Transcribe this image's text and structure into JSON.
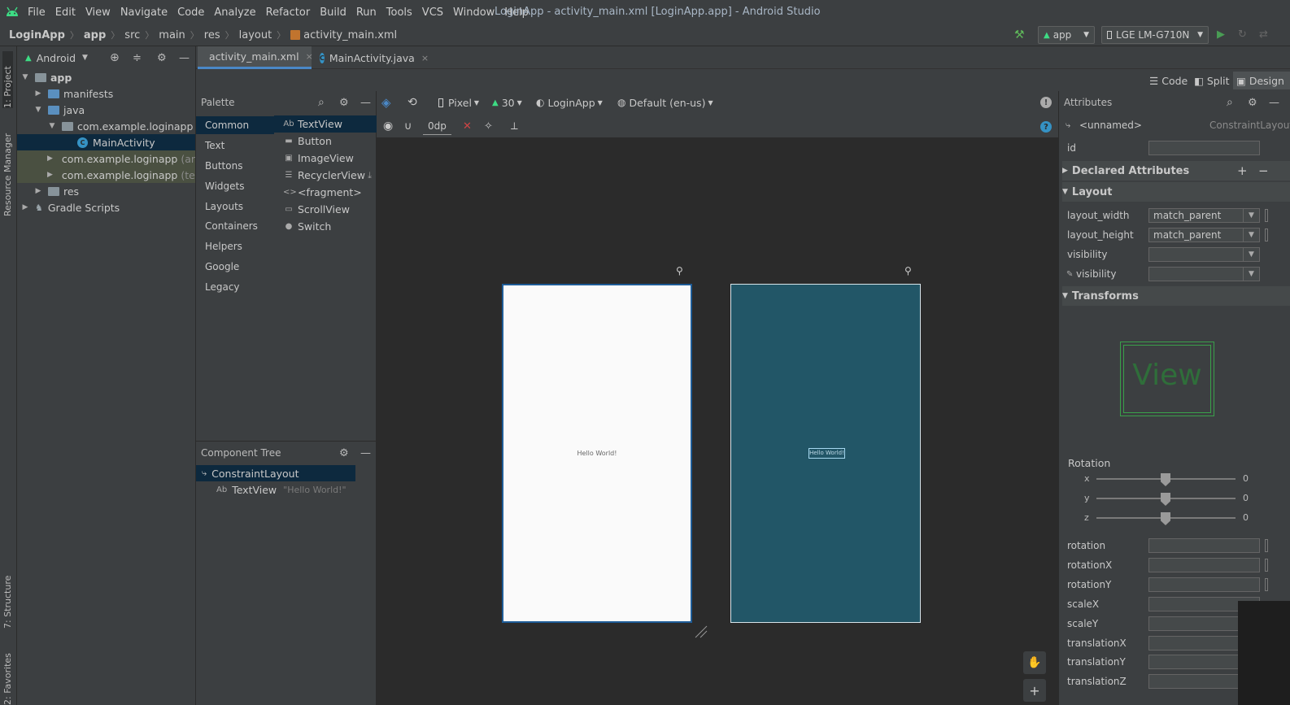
{
  "window": {
    "title": "LoginApp - activity_main.xml [LoginApp.app] - Android Studio",
    "menu": [
      "File",
      "Edit",
      "View",
      "Navigate",
      "Code",
      "Analyze",
      "Refactor",
      "Build",
      "Run",
      "Tools",
      "VCS",
      "Window",
      "Help"
    ]
  },
  "breadcrumb": [
    "LoginApp",
    "app",
    "src",
    "main",
    "res",
    "layout",
    "activity_main.xml"
  ],
  "run_config": {
    "module": "app",
    "device": "LGE LM-G710N"
  },
  "left_strip": {
    "project": "1: Project",
    "resource_manager": "Resource Manager",
    "structure": "7: Structure",
    "favorites": "2: Favorites"
  },
  "project_panel": {
    "view_mode": "Android",
    "tree": [
      {
        "label": "app",
        "suffix": ""
      },
      {
        "label": "manifests",
        "suffix": ""
      },
      {
        "label": "java",
        "suffix": ""
      },
      {
        "label": "com.example.loginapp",
        "suffix": ""
      },
      {
        "label": "MainActivity",
        "suffix": ""
      },
      {
        "label": "com.example.loginapp",
        "suffix": "(and"
      },
      {
        "label": "com.example.loginapp",
        "suffix": "(test"
      },
      {
        "label": "res",
        "suffix": ""
      },
      {
        "label": "Gradle Scripts",
        "suffix": ""
      }
    ]
  },
  "editor": {
    "tabs": [
      {
        "label": "activity_main.xml",
        "close": "×"
      },
      {
        "label": "MainActivity.java",
        "close": "×"
      }
    ],
    "modes": {
      "code": "Code",
      "split": "Split",
      "design": "Design"
    }
  },
  "palette": {
    "title": "Palette",
    "categories": [
      "Common",
      "Text",
      "Buttons",
      "Widgets",
      "Layouts",
      "Containers",
      "Helpers",
      "Google",
      "Legacy"
    ],
    "items": [
      {
        "icon": "Ab",
        "label": "TextView"
      },
      {
        "icon": "▬",
        "label": "Button"
      },
      {
        "icon": "▣",
        "label": "ImageView"
      },
      {
        "icon": "☰",
        "label": "RecyclerView"
      },
      {
        "icon": "<>",
        "label": "<fragment>"
      },
      {
        "icon": "▭",
        "label": "ScrollView"
      },
      {
        "icon": "●",
        "label": "Switch"
      }
    ]
  },
  "component_tree": {
    "title": "Component Tree",
    "root": "ConstraintLayout",
    "child": {
      "icon": "Ab",
      "label": "TextView",
      "hint": "\"Hello World!\""
    }
  },
  "design_toolbar": {
    "device": "Pixel",
    "api": "30",
    "theme": "LoginApp",
    "locale": "Default (en-us)",
    "margin": "0dp"
  },
  "canvas": {
    "design_text": "Hello World!",
    "blueprint_text": "Hello World!"
  },
  "attributes": {
    "title": "Attributes",
    "component_name": "<unnamed>",
    "component_type": "ConstraintLayout",
    "id_label": "id",
    "declared": "Declared Attributes",
    "layout": "Layout",
    "layout_rows": [
      {
        "label": "layout_width",
        "value": "match_parent"
      },
      {
        "label": "layout_height",
        "value": "match_parent"
      },
      {
        "label": "visibility",
        "value": ""
      },
      {
        "label": "visibility",
        "value": ""
      }
    ],
    "transforms": "Transforms",
    "view_preview": "View",
    "rotation_title": "Rotation",
    "rotation_axes": [
      {
        "axis": "x",
        "value": "0"
      },
      {
        "axis": "y",
        "value": "0"
      },
      {
        "axis": "z",
        "value": "0"
      }
    ],
    "transform_fields": [
      "rotation",
      "rotationX",
      "rotationY",
      "scaleX",
      "scaleY",
      "translationX",
      "translationY",
      "translationZ"
    ]
  },
  "colors": {
    "background": "#2b2b2b",
    "panel": "#3c3f41",
    "selection": "#0d293e",
    "accent": "#4a88c7",
    "android_green": "#3ddc84",
    "blueprint": "#225667"
  }
}
